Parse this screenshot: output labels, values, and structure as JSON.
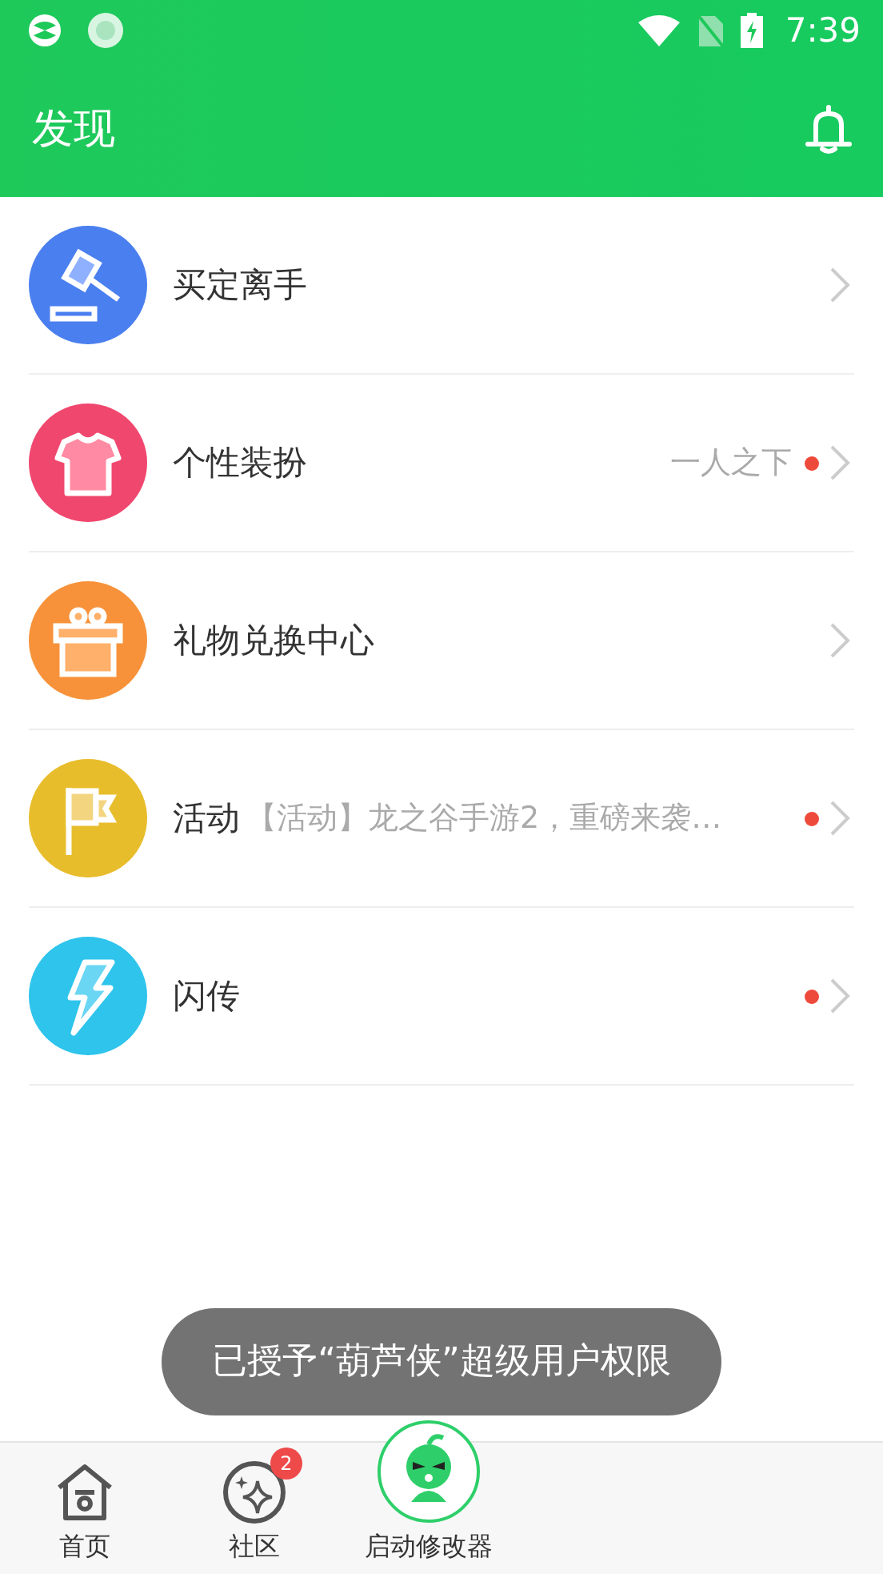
{
  "status_bar": {
    "time": "7:39"
  },
  "toolbar": {
    "title": "发现"
  },
  "items": [
    {
      "title": "买定离手",
      "color": "#4a7ff0",
      "unread": false
    },
    {
      "title": "个性装扮",
      "color": "#f0476f",
      "note": "一人之下",
      "unread": true
    },
    {
      "title": "礼物兑换中心",
      "color": "#f7923a",
      "unread": false
    },
    {
      "title": "活动",
      "color": "#e8bd2c",
      "preview": "【活动】龙之谷手游2，重磅来袭…",
      "unread": true
    },
    {
      "title": "闪传",
      "color": "#2ec4ec",
      "unread": true
    }
  ],
  "toast": "已授予“葫芦侠”超级用户权限",
  "bottom_nav": [
    {
      "label": "首页",
      "kind": "home"
    },
    {
      "label": "社区",
      "kind": "community",
      "badge": "2"
    },
    {
      "label": "启动修改器",
      "kind": "launch"
    }
  ]
}
